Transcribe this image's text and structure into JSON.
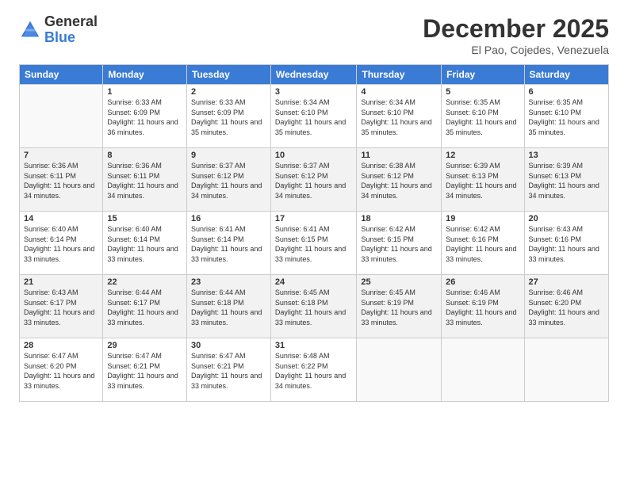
{
  "logo": {
    "general": "General",
    "blue": "Blue"
  },
  "title": "December 2025",
  "location": "El Pao, Cojedes, Venezuela",
  "headers": [
    "Sunday",
    "Monday",
    "Tuesday",
    "Wednesday",
    "Thursday",
    "Friday",
    "Saturday"
  ],
  "rows": [
    [
      {
        "day": "",
        "sunrise": "",
        "sunset": "",
        "daylight": "",
        "empty": true
      },
      {
        "day": "1",
        "sunrise": "Sunrise: 6:33 AM",
        "sunset": "Sunset: 6:09 PM",
        "daylight": "Daylight: 11 hours and 36 minutes."
      },
      {
        "day": "2",
        "sunrise": "Sunrise: 6:33 AM",
        "sunset": "Sunset: 6:09 PM",
        "daylight": "Daylight: 11 hours and 35 minutes."
      },
      {
        "day": "3",
        "sunrise": "Sunrise: 6:34 AM",
        "sunset": "Sunset: 6:10 PM",
        "daylight": "Daylight: 11 hours and 35 minutes."
      },
      {
        "day": "4",
        "sunrise": "Sunrise: 6:34 AM",
        "sunset": "Sunset: 6:10 PM",
        "daylight": "Daylight: 11 hours and 35 minutes."
      },
      {
        "day": "5",
        "sunrise": "Sunrise: 6:35 AM",
        "sunset": "Sunset: 6:10 PM",
        "daylight": "Daylight: 11 hours and 35 minutes."
      },
      {
        "day": "6",
        "sunrise": "Sunrise: 6:35 AM",
        "sunset": "Sunset: 6:10 PM",
        "daylight": "Daylight: 11 hours and 35 minutes."
      }
    ],
    [
      {
        "day": "7",
        "sunrise": "Sunrise: 6:36 AM",
        "sunset": "Sunset: 6:11 PM",
        "daylight": "Daylight: 11 hours and 34 minutes."
      },
      {
        "day": "8",
        "sunrise": "Sunrise: 6:36 AM",
        "sunset": "Sunset: 6:11 PM",
        "daylight": "Daylight: 11 hours and 34 minutes."
      },
      {
        "day": "9",
        "sunrise": "Sunrise: 6:37 AM",
        "sunset": "Sunset: 6:12 PM",
        "daylight": "Daylight: 11 hours and 34 minutes."
      },
      {
        "day": "10",
        "sunrise": "Sunrise: 6:37 AM",
        "sunset": "Sunset: 6:12 PM",
        "daylight": "Daylight: 11 hours and 34 minutes."
      },
      {
        "day": "11",
        "sunrise": "Sunrise: 6:38 AM",
        "sunset": "Sunset: 6:12 PM",
        "daylight": "Daylight: 11 hours and 34 minutes."
      },
      {
        "day": "12",
        "sunrise": "Sunrise: 6:39 AM",
        "sunset": "Sunset: 6:13 PM",
        "daylight": "Daylight: 11 hours and 34 minutes."
      },
      {
        "day": "13",
        "sunrise": "Sunrise: 6:39 AM",
        "sunset": "Sunset: 6:13 PM",
        "daylight": "Daylight: 11 hours and 34 minutes."
      }
    ],
    [
      {
        "day": "14",
        "sunrise": "Sunrise: 6:40 AM",
        "sunset": "Sunset: 6:14 PM",
        "daylight": "Daylight: 11 hours and 33 minutes."
      },
      {
        "day": "15",
        "sunrise": "Sunrise: 6:40 AM",
        "sunset": "Sunset: 6:14 PM",
        "daylight": "Daylight: 11 hours and 33 minutes."
      },
      {
        "day": "16",
        "sunrise": "Sunrise: 6:41 AM",
        "sunset": "Sunset: 6:14 PM",
        "daylight": "Daylight: 11 hours and 33 minutes."
      },
      {
        "day": "17",
        "sunrise": "Sunrise: 6:41 AM",
        "sunset": "Sunset: 6:15 PM",
        "daylight": "Daylight: 11 hours and 33 minutes."
      },
      {
        "day": "18",
        "sunrise": "Sunrise: 6:42 AM",
        "sunset": "Sunset: 6:15 PM",
        "daylight": "Daylight: 11 hours and 33 minutes."
      },
      {
        "day": "19",
        "sunrise": "Sunrise: 6:42 AM",
        "sunset": "Sunset: 6:16 PM",
        "daylight": "Daylight: 11 hours and 33 minutes."
      },
      {
        "day": "20",
        "sunrise": "Sunrise: 6:43 AM",
        "sunset": "Sunset: 6:16 PM",
        "daylight": "Daylight: 11 hours and 33 minutes."
      }
    ],
    [
      {
        "day": "21",
        "sunrise": "Sunrise: 6:43 AM",
        "sunset": "Sunset: 6:17 PM",
        "daylight": "Daylight: 11 hours and 33 minutes."
      },
      {
        "day": "22",
        "sunrise": "Sunrise: 6:44 AM",
        "sunset": "Sunset: 6:17 PM",
        "daylight": "Daylight: 11 hours and 33 minutes."
      },
      {
        "day": "23",
        "sunrise": "Sunrise: 6:44 AM",
        "sunset": "Sunset: 6:18 PM",
        "daylight": "Daylight: 11 hours and 33 minutes."
      },
      {
        "day": "24",
        "sunrise": "Sunrise: 6:45 AM",
        "sunset": "Sunset: 6:18 PM",
        "daylight": "Daylight: 11 hours and 33 minutes."
      },
      {
        "day": "25",
        "sunrise": "Sunrise: 6:45 AM",
        "sunset": "Sunset: 6:19 PM",
        "daylight": "Daylight: 11 hours and 33 minutes."
      },
      {
        "day": "26",
        "sunrise": "Sunrise: 6:46 AM",
        "sunset": "Sunset: 6:19 PM",
        "daylight": "Daylight: 11 hours and 33 minutes."
      },
      {
        "day": "27",
        "sunrise": "Sunrise: 6:46 AM",
        "sunset": "Sunset: 6:20 PM",
        "daylight": "Daylight: 11 hours and 33 minutes."
      }
    ],
    [
      {
        "day": "28",
        "sunrise": "Sunrise: 6:47 AM",
        "sunset": "Sunset: 6:20 PM",
        "daylight": "Daylight: 11 hours and 33 minutes."
      },
      {
        "day": "29",
        "sunrise": "Sunrise: 6:47 AM",
        "sunset": "Sunset: 6:21 PM",
        "daylight": "Daylight: 11 hours and 33 minutes."
      },
      {
        "day": "30",
        "sunrise": "Sunrise: 6:47 AM",
        "sunset": "Sunset: 6:21 PM",
        "daylight": "Daylight: 11 hours and 33 minutes."
      },
      {
        "day": "31",
        "sunrise": "Sunrise: 6:48 AM",
        "sunset": "Sunset: 6:22 PM",
        "daylight": "Daylight: 11 hours and 34 minutes."
      },
      {
        "day": "",
        "sunrise": "",
        "sunset": "",
        "daylight": "",
        "empty": true
      },
      {
        "day": "",
        "sunrise": "",
        "sunset": "",
        "daylight": "",
        "empty": true
      },
      {
        "day": "",
        "sunrise": "",
        "sunset": "",
        "daylight": "",
        "empty": true
      }
    ]
  ]
}
